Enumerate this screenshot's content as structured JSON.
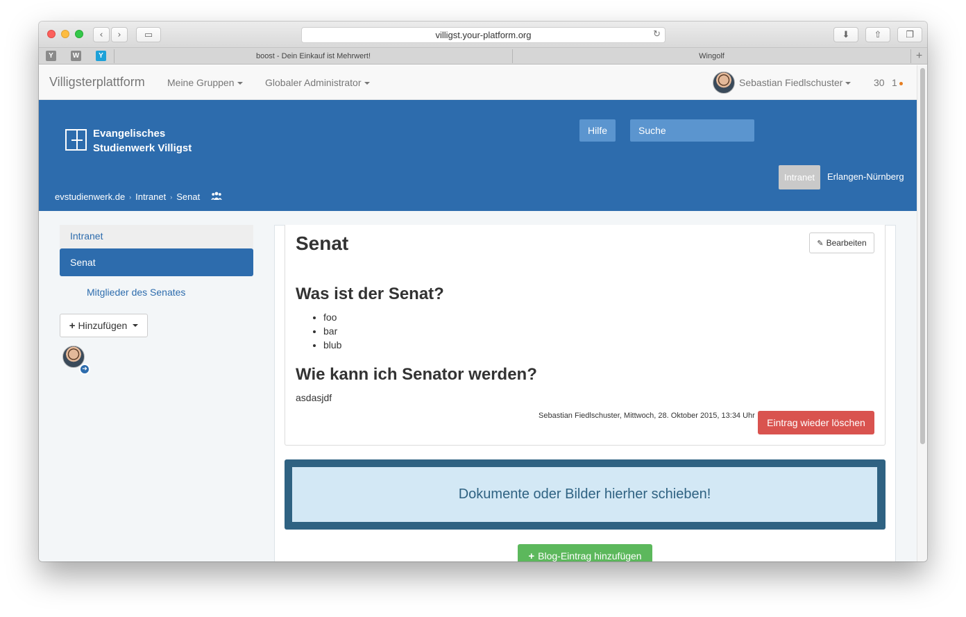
{
  "browser": {
    "url": "villigst.your-platform.org",
    "tabs": [
      {
        "label": "boost - Dein Einkauf ist Mehrwert!"
      },
      {
        "label": "Wingolf"
      }
    ],
    "pinned_tabs": [
      {
        "icon": "y-combinator-icon",
        "letter": "Y",
        "color": "#8a8a8a"
      },
      {
        "icon": "wikipedia-icon",
        "letter": "W",
        "color": "#8a8a8a"
      },
      {
        "icon": "yammer-icon",
        "letter": "Y",
        "color": "#1da1d8"
      }
    ]
  },
  "navbar": {
    "brand": "Villigsterplattform",
    "items": [
      {
        "label": "Meine Gruppen"
      },
      {
        "label": "Globaler Administrator"
      }
    ],
    "user": "Sebastian Fiedlschuster",
    "count": "30",
    "notifications": "1"
  },
  "header": {
    "logo_line1": "Evangelisches",
    "logo_line2": "Studienwerk Villigst",
    "help_label": "Hilfe",
    "search_placeholder": "Suche",
    "pills": [
      {
        "label": "Intranet",
        "active": true
      },
      {
        "label": "Erlangen-Nürnberg",
        "active": false
      }
    ],
    "breadcrumb": [
      "evstudienwerk.de",
      "Intranet",
      "Senat"
    ]
  },
  "sidebar": {
    "items": [
      {
        "label": "Intranet"
      },
      {
        "label": "Senat"
      },
      {
        "label": "Mitglieder des Senates"
      }
    ],
    "add_label": "Hinzufügen"
  },
  "main": {
    "title": "Senat",
    "edit_label": "Bearbeiten",
    "heading1": "Was ist der Senat?",
    "list": [
      "foo",
      "bar",
      "blub"
    ],
    "heading2": "Wie kann ich Senator werden?",
    "paragraph": "asdasjdf",
    "meta": "Sebastian Fiedlschuster, Mittwoch, 28. Oktober 2015, 13:34 Uhr",
    "delete_label": "Eintrag wieder löschen",
    "dropzone": "Dokumente oder Bilder hierher schieben!",
    "blog_label": "Blog-Eintrag hinzufügen"
  },
  "colors": {
    "brand_blue": "#2d6cad",
    "danger": "#d9534f",
    "success": "#5cb85c",
    "dropzone_border": "#2f6282"
  }
}
